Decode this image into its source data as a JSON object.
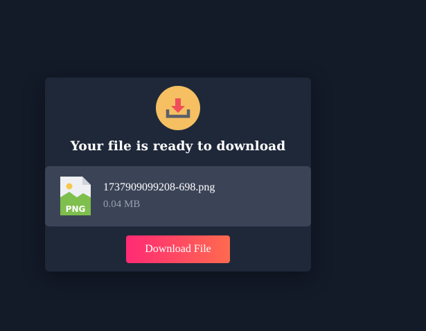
{
  "dialog": {
    "title": "Your file is ready to download",
    "download_icon": "download-tray-icon"
  },
  "file": {
    "name": "1737909099208-698.png",
    "size": "0.04 MB",
    "type_label": "PNG",
    "icon": "png-image-file-icon"
  },
  "actions": {
    "download_label": "Download File"
  },
  "colors": {
    "page_background": "#131a28",
    "card_background": "#1f2839",
    "file_row_background": "#3b4457",
    "badge": "#f5bf62",
    "arrow": "#f04d5a",
    "button_gradient_start": "#ff2a74",
    "button_gradient_end": "#ff6a4f"
  }
}
